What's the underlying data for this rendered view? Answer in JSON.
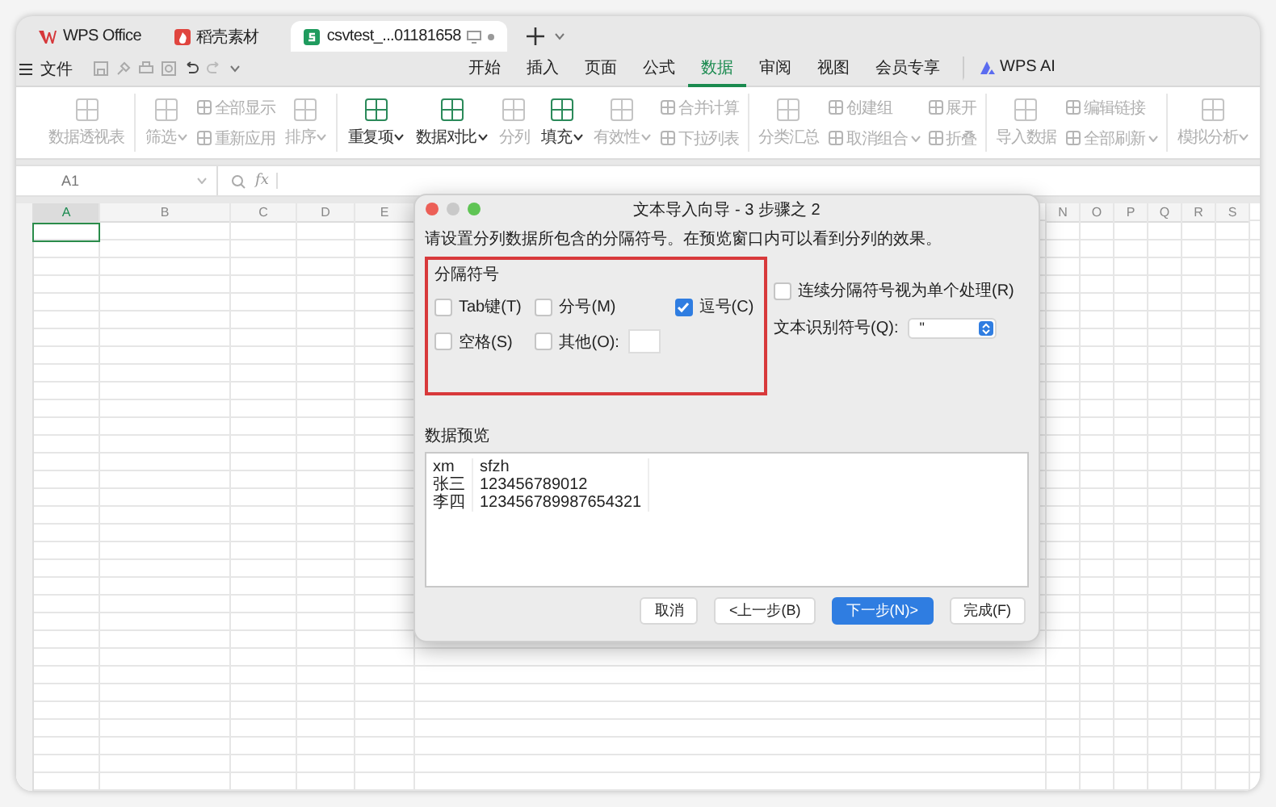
{
  "tabs": [
    {
      "label": "WPS Office",
      "kind": "app",
      "selected": false
    },
    {
      "label": "稻壳素材",
      "kind": "docer",
      "selected": false
    },
    {
      "label": "csvtest_...01181658",
      "kind": "sheet",
      "selected": true
    }
  ],
  "menu": {
    "file": "文件",
    "tabs": [
      {
        "label": "开始",
        "selected": false
      },
      {
        "label": "插入",
        "selected": false
      },
      {
        "label": "页面",
        "selected": false
      },
      {
        "label": "公式",
        "selected": false
      },
      {
        "label": "数据",
        "selected": true
      },
      {
        "label": "审阅",
        "selected": false
      },
      {
        "label": "视图",
        "selected": false
      },
      {
        "label": "会员专享",
        "selected": false
      }
    ],
    "ai": "WPS AI"
  },
  "ribbon": {
    "groups": [
      [
        {
          "kind": "big",
          "label": "数据透视表",
          "disabled": true,
          "dropdown": false
        }
      ],
      [
        {
          "kind": "big",
          "label": "筛选",
          "disabled": true,
          "dropdown": true
        },
        {
          "kind": "stack",
          "items": [
            {
              "label": "全部显示",
              "disabled": true,
              "dropdown": false
            },
            {
              "label": "重新应用",
              "disabled": true,
              "dropdown": false
            }
          ]
        },
        {
          "kind": "big",
          "label": "排序",
          "disabled": true,
          "dropdown": true
        }
      ],
      [
        {
          "kind": "big",
          "label": "重复项",
          "disabled": false,
          "dropdown": true
        },
        {
          "kind": "big",
          "label": "数据对比",
          "disabled": false,
          "dropdown": true
        },
        {
          "kind": "big",
          "label": "分列",
          "disabled": true,
          "dropdown": false
        },
        {
          "kind": "big",
          "label": "填充",
          "disabled": false,
          "dropdown": true
        },
        {
          "kind": "big",
          "label": "有效性",
          "disabled": true,
          "dropdown": true
        },
        {
          "kind": "stack",
          "items": [
            {
              "label": "合并计算",
              "disabled": true,
              "dropdown": false
            },
            {
              "label": "下拉列表",
              "disabled": true,
              "dropdown": false
            }
          ]
        }
      ],
      [
        {
          "kind": "big",
          "label": "分类汇总",
          "disabled": true,
          "dropdown": false
        },
        {
          "kind": "stack",
          "items": [
            {
              "label": "创建组",
              "disabled": true,
              "dropdown": false
            },
            {
              "label": "取消组合",
              "disabled": true,
              "dropdown": true
            }
          ]
        },
        {
          "kind": "stack",
          "items": [
            {
              "label": "展开",
              "disabled": true,
              "dropdown": false
            },
            {
              "label": "折叠",
              "disabled": true,
              "dropdown": false
            }
          ]
        }
      ],
      [
        {
          "kind": "big",
          "label": "导入数据",
          "disabled": true,
          "dropdown": false
        },
        {
          "kind": "stack",
          "items": [
            {
              "label": "编辑链接",
              "disabled": true,
              "dropdown": false
            },
            {
              "label": "全部刷新",
              "disabled": true,
              "dropdown": true
            }
          ]
        }
      ],
      [
        {
          "kind": "big",
          "label": "模拟分析",
          "disabled": true,
          "dropdown": true
        }
      ]
    ]
  },
  "formula_bar": {
    "name_box": "A1",
    "fx": "fx"
  },
  "sheet": {
    "columns": [
      {
        "label": "A",
        "selected": true
      },
      {
        "label": "B",
        "selected": false
      },
      {
        "label": "C",
        "selected": false
      },
      {
        "label": "D",
        "selected": false
      },
      {
        "label": "E",
        "selected": false
      },
      {
        "label": "N",
        "selected": false
      },
      {
        "label": "O",
        "selected": false
      },
      {
        "label": "P",
        "selected": false
      },
      {
        "label": "Q",
        "selected": false
      },
      {
        "label": "R",
        "selected": false
      },
      {
        "label": "S",
        "selected": false
      }
    ]
  },
  "dialog": {
    "title": "文本导入向导 - 3 步骤之 2",
    "instruction": "请设置分列数据所包含的分隔符号。在预览窗口内可以看到分列的效果。",
    "delimiters": {
      "title": "分隔符号",
      "highlighted": true,
      "options": [
        {
          "kind": "checkbox",
          "label": "Tab键(T)",
          "checked": false
        },
        {
          "kind": "checkbox",
          "label": "分号(M)",
          "checked": false
        },
        {
          "kind": "checkbox",
          "label": "逗号(C)",
          "checked": true
        },
        {
          "kind": "checkbox",
          "label": "空格(S)",
          "checked": false
        },
        {
          "kind": "checkbox_field",
          "label": "其他(O):",
          "checked": false
        }
      ]
    },
    "consecutive": {
      "label": "连续分隔符号视为单个处理(R)",
      "checked": false
    },
    "qualifier": {
      "label": "文本识别符号(Q):",
      "value": "\""
    },
    "preview": {
      "title": "数据预览",
      "rows": [
        [
          "xm",
          "sfzh"
        ],
        [
          "张三",
          "123456789012"
        ],
        [
          "李四",
          "123456789987654321"
        ]
      ]
    },
    "buttons": [
      {
        "label": "取消",
        "primary": false
      },
      {
        "label": "<上一步(B)",
        "primary": false
      },
      {
        "label": "下一步(N)>",
        "primary": true
      },
      {
        "label": "完成(F)",
        "primary": false
      }
    ]
  }
}
